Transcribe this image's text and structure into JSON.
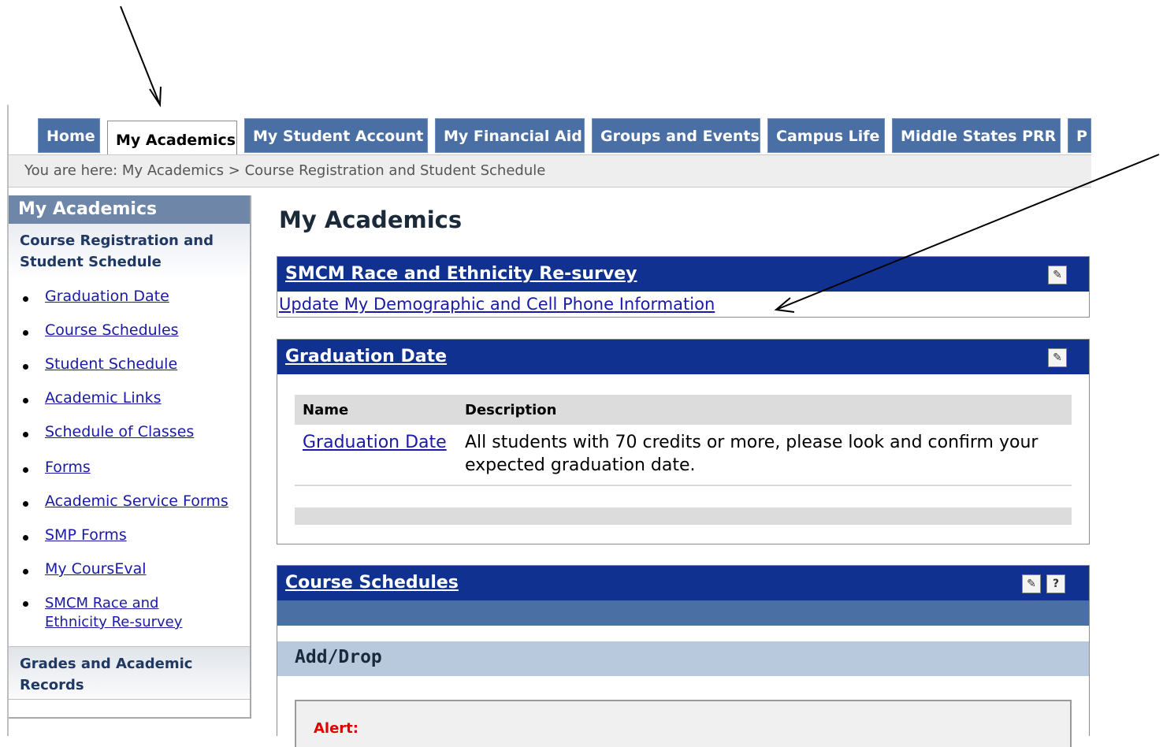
{
  "tabs": [
    {
      "label": "Home",
      "active": false
    },
    {
      "label": "My Academics",
      "active": true
    },
    {
      "label": "My Student Account",
      "active": false
    },
    {
      "label": "My Financial Aid",
      "active": false
    },
    {
      "label": "Groups and Events",
      "active": false
    },
    {
      "label": "Campus Life",
      "active": false
    },
    {
      "label": "Middle States PRR",
      "active": false
    },
    {
      "label": "P",
      "active": false
    }
  ],
  "breadcrumb": "You are here:  My Academics > Course Registration and Student Schedule",
  "sidebar": {
    "title": "My Academics",
    "section": "Course Registration and Student Schedule",
    "items": [
      {
        "label": "Graduation Date"
      },
      {
        "label": "Course Schedules"
      },
      {
        "label": "Student Schedule"
      },
      {
        "label": "Academic Links"
      },
      {
        "label": "Schedule of Classes"
      },
      {
        "label": "Forms"
      },
      {
        "label": "Academic Service Forms"
      },
      {
        "label": "SMP Forms"
      },
      {
        "label": "My CoursEval"
      },
      {
        "label": "SMCM Race and Ethnicity Re-survey"
      }
    ],
    "section2": "Grades and Academic Records"
  },
  "page_title": "My Academics",
  "race_portlet": {
    "title": "SMCM Race and Ethnicity Re-survey",
    "link": "Update My Demographic and Cell Phone Information"
  },
  "graduation_portlet": {
    "title": "Graduation Date",
    "headers": {
      "name": "Name",
      "description": "Description"
    },
    "row": {
      "name": "Graduation Date",
      "description": "All students with 70 credits or more, please look and confirm your expected graduation date."
    }
  },
  "course_portlet": {
    "title": "Course Schedules",
    "subheading": "Add/Drop",
    "alert_label": "Alert:",
    "help_icon": "?"
  },
  "colors": {
    "tab_blue": "#4a6fa5",
    "portlet_header": "#10318f",
    "link": "#1a1aa6",
    "alert": "#e00000"
  },
  "icons": [
    "settings-wrench-icon",
    "help-icon"
  ]
}
